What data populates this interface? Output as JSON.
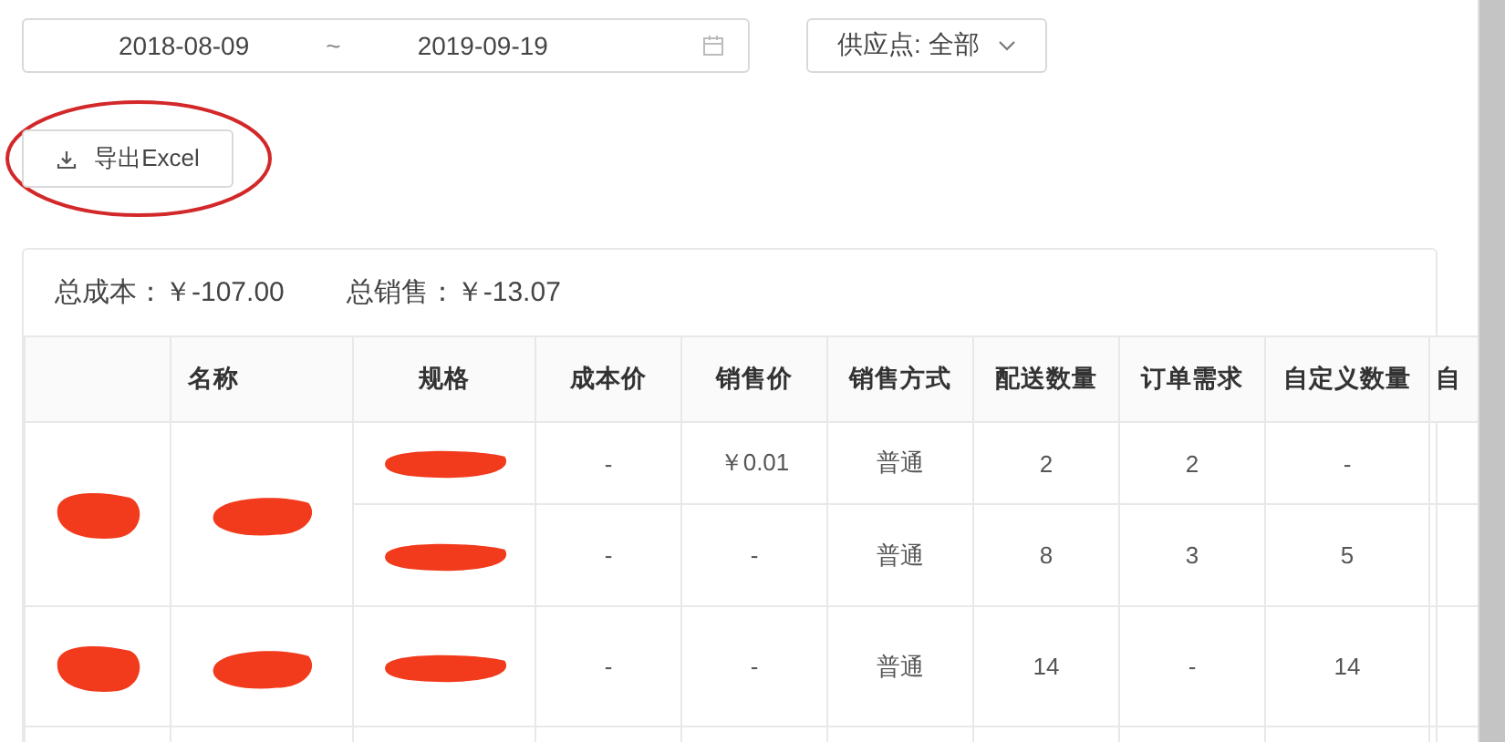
{
  "date_range": {
    "start": "2018-08-09",
    "separator": "~",
    "end": "2019-09-19"
  },
  "supplier_filter": {
    "label": "供应点: 全部"
  },
  "export_button": {
    "label": "导出Excel",
    "circled": true
  },
  "summary": [
    {
      "label": "总成本：",
      "value": "￥-107.00"
    },
    {
      "label": "总销售：",
      "value": "￥-13.07"
    }
  ],
  "table": {
    "columns": [
      "名称",
      "规格",
      "成本价",
      "销售价",
      "销售方式",
      "配送数量",
      "订单需求",
      "自定义数量",
      "自"
    ],
    "groups": [
      {
        "column_1": {
          "redacted": true
        },
        "name": {
          "redacted": true
        },
        "items": [
          {
            "spec": {
              "redacted": true
            },
            "cost": "-",
            "price": "￥0.01",
            "mode": "普通",
            "delivered": "2",
            "ordered": "2",
            "custom": "-"
          },
          {
            "spec": {
              "redacted": true
            },
            "cost": "-",
            "price": "-",
            "mode": "普通",
            "delivered": "8",
            "ordered": "3",
            "custom": "5"
          }
        ]
      },
      {
        "column_1": {
          "redacted": true
        },
        "name": {
          "redacted": true
        },
        "items": [
          {
            "spec": {
              "redacted": true
            },
            "cost": "-",
            "price": "-",
            "mode": "普通",
            "delivered": "14",
            "ordered": "-",
            "custom": "14"
          }
        ]
      }
    ]
  }
}
